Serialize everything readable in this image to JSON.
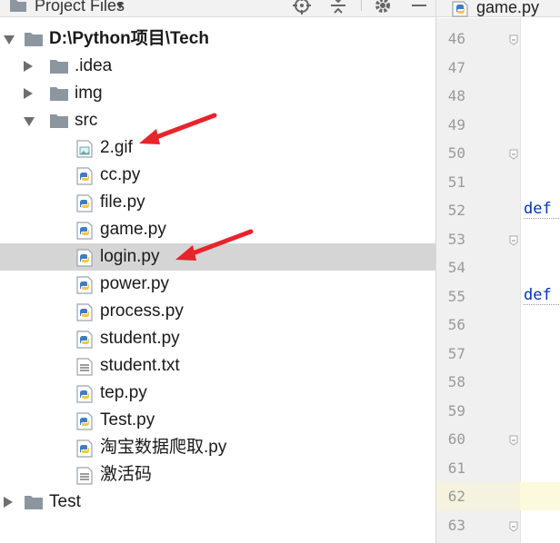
{
  "panel": {
    "title": "Project Files"
  },
  "tree": [
    {
      "label": "D:\\Python项目\\Tech",
      "name": "tree-root-tech",
      "icon": "folder",
      "arrow": "down",
      "depth": 0,
      "bold": true
    },
    {
      "label": ".idea",
      "name": "tree-item-idea",
      "icon": "folder",
      "arrow": "right",
      "depth": 1
    },
    {
      "label": "img",
      "name": "tree-item-img",
      "icon": "folder",
      "arrow": "right",
      "depth": 1
    },
    {
      "label": "src",
      "name": "tree-item-src",
      "icon": "folder",
      "arrow": "down",
      "depth": 1
    },
    {
      "label": "2.gif",
      "name": "tree-item-2-gif",
      "icon": "image",
      "depth": 2
    },
    {
      "label": "cc.py",
      "name": "tree-item-cc-py",
      "icon": "python",
      "depth": 2
    },
    {
      "label": "file.py",
      "name": "tree-item-file-py",
      "icon": "python",
      "depth": 2
    },
    {
      "label": "game.py",
      "name": "tree-item-game-py",
      "icon": "python",
      "depth": 2
    },
    {
      "label": "login.py",
      "name": "tree-item-login-py",
      "icon": "python",
      "depth": 2,
      "selected": true
    },
    {
      "label": "power.py",
      "name": "tree-item-power-py",
      "icon": "python",
      "depth": 2
    },
    {
      "label": "process.py",
      "name": "tree-item-process-py",
      "icon": "python",
      "depth": 2
    },
    {
      "label": "student.py",
      "name": "tree-item-student-py",
      "icon": "python",
      "depth": 2
    },
    {
      "label": "student.txt",
      "name": "tree-item-student-txt",
      "icon": "text",
      "depth": 2
    },
    {
      "label": "tep.py",
      "name": "tree-item-tep-py",
      "icon": "python",
      "depth": 2
    },
    {
      "label": "Test.py",
      "name": "tree-item-test-py",
      "icon": "python",
      "depth": 2
    },
    {
      "label": "淘宝数据爬取.py",
      "name": "tree-item-taobao-py",
      "icon": "python",
      "depth": 2
    },
    {
      "label": "激活码",
      "name": "tree-item-activation-code",
      "icon": "text",
      "depth": 2
    },
    {
      "label": "Test",
      "name": "tree-item-test-folder",
      "icon": "folder",
      "arrow": "right",
      "depth": 0
    }
  ],
  "editor": {
    "tab_label": "game.py",
    "line_numbers": [
      "46",
      "47",
      "48",
      "49",
      "50",
      "51",
      "52",
      "53",
      "54",
      "55",
      "56",
      "57",
      "58",
      "59",
      "60",
      "61",
      "62",
      "63"
    ],
    "current_line": "62",
    "code_lines": {
      "52": "def",
      "55": "def"
    }
  },
  "colors": {
    "annotation_arrow": "#e8232b",
    "python_blue": "#3f7cc4",
    "python_yellow": "#f6c744",
    "folder": "#8c969f",
    "keyword": "#0033b3"
  }
}
